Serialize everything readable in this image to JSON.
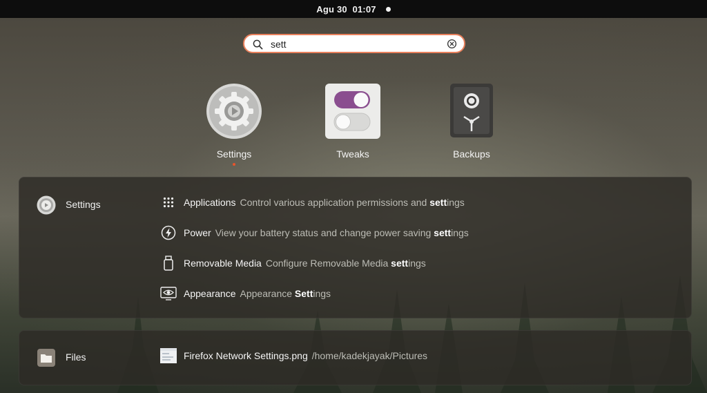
{
  "topbar": {
    "clock": "Agu 30  01:07"
  },
  "search": {
    "value": "sett",
    "placeholder": ""
  },
  "apps": [
    {
      "label": "Settings",
      "icon": "settings-gear-icon",
      "running": true
    },
    {
      "label": "Tweaks",
      "icon": "tweaks-toggle-icon",
      "running": false
    },
    {
      "label": "Backups",
      "icon": "backups-safe-icon",
      "running": false
    }
  ],
  "settings_provider": {
    "name": "Settings",
    "results": [
      {
        "name": "Applications",
        "desc_pre": "Control various application permissions and ",
        "desc_match": "sett",
        "desc_post": "ings",
        "icon": "app-grid-icon"
      },
      {
        "name": "Power",
        "desc_pre": "View your battery status and change power saving ",
        "desc_match": "sett",
        "desc_post": "ings",
        "icon": "power-icon"
      },
      {
        "name": "Removable Media",
        "desc_pre": "Configure Removable Media ",
        "desc_match": "sett",
        "desc_post": "ings",
        "icon": "usb-drive-icon"
      },
      {
        "name": "Appearance",
        "desc_pre": "Appearance ",
        "desc_match": "Sett",
        "desc_post": "ings",
        "icon": "appearance-icon"
      }
    ]
  },
  "files_provider": {
    "name": "Files",
    "results": [
      {
        "name": "Firefox Network Settings.png",
        "desc": "/home/kadekjayak/Pictures",
        "icon": "image-thumbnail-icon"
      }
    ]
  },
  "colors": {
    "accent": "#e9805c",
    "running_dot": "#e9542c",
    "tweaks_toggle": "#8a4e8f"
  }
}
